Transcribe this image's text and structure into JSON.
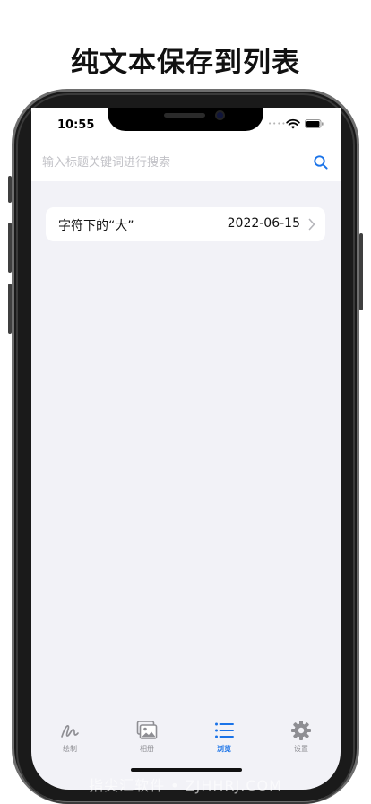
{
  "headline": "纯文本保存到列表",
  "status_bar": {
    "time": "10:55",
    "signal_dots": "••••"
  },
  "search": {
    "placeholder": "输入标题关键词进行搜索",
    "value": ""
  },
  "list": [
    {
      "title": "字符下的“大”",
      "date": "2022-06-15"
    }
  ],
  "tabs": [
    {
      "label": "绘制",
      "icon": "draw-icon",
      "active": false
    },
    {
      "label": "相册",
      "icon": "album-icon",
      "active": false
    },
    {
      "label": "浏览",
      "icon": "list-icon",
      "active": true
    },
    {
      "label": "设置",
      "icon": "gear-icon",
      "active": false
    }
  ],
  "colors": {
    "accent": "#1a73e8",
    "inactive": "#8e8e93",
    "background": "#f2f2f7"
  },
  "watermark": "指尖汇软件 • ZJHHRJ.COM"
}
